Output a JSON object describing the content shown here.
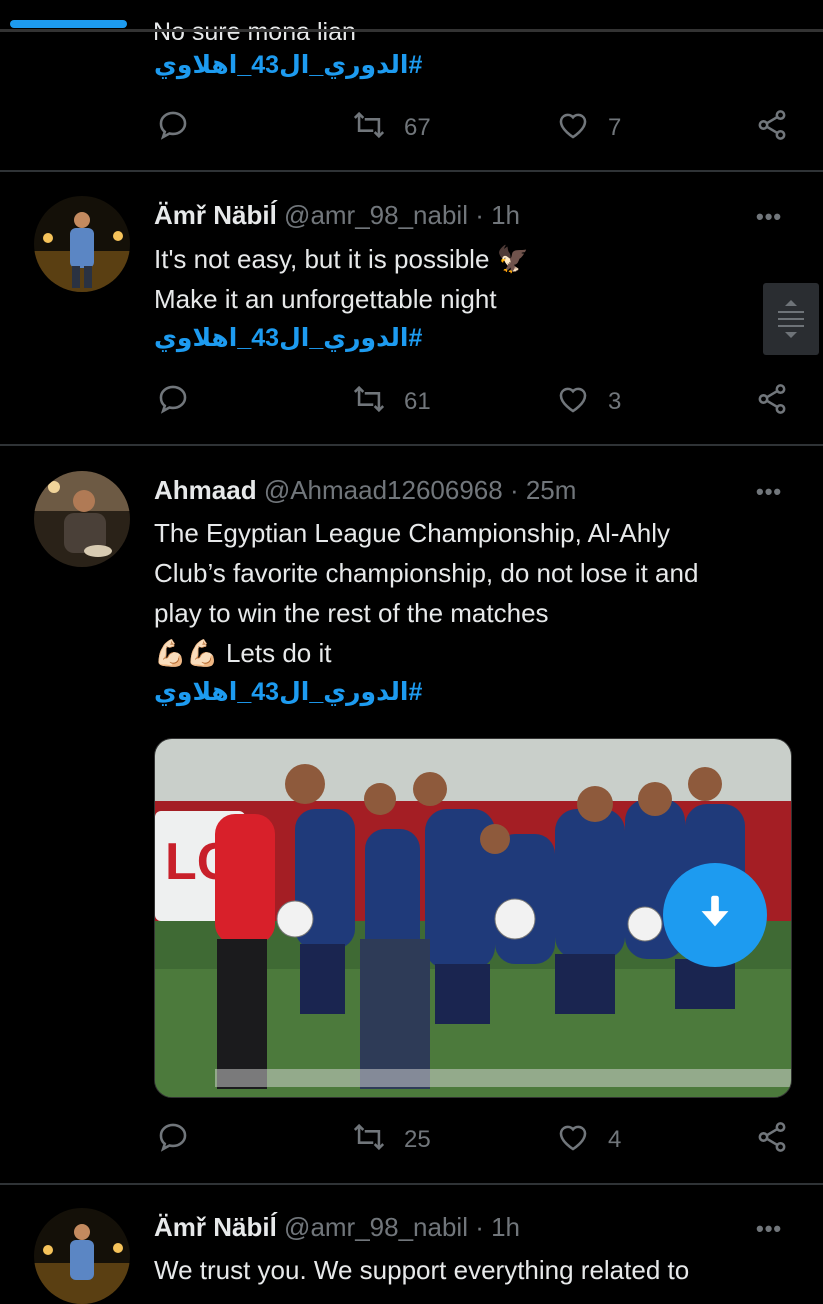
{
  "top_tweet": {
    "cut_text": "No sure mona lian",
    "hashtag": "#الدوري_ال43_اهلاوي",
    "retweets": "67",
    "likes": "7"
  },
  "tweets": [
    {
      "name": "Ämř Näbiĺ",
      "handle": "@amr_98_nabil · 1h",
      "lines": [
        "It's not easy, but it is possible 🦅",
        "Make it an unforgettable night"
      ],
      "hashtag": "#الدوري_ال43_اهلاوي",
      "retweets": "61",
      "likes": "3"
    },
    {
      "name": "Ahmaad",
      "handle": "@Ahmaad12606968 · 25m",
      "lines": [
        "The Egyptian League Championship, Al-Ahly",
        "Club’s favorite championship, do not lose it and",
        "play to win the rest of the matches",
        "💪🏻💪🏻 Lets do it"
      ],
      "hashtag": "#الدوري_ال43_اهلاوي",
      "retweets": "25",
      "likes": "4"
    },
    {
      "name": "Ämř Näbiĺ",
      "handle": "@amr_98_nabil · 1h",
      "lines": [
        "We trust you. We support everything related to"
      ]
    }
  ],
  "icons": {
    "reply": "reply-icon",
    "retweet": "retweet-icon",
    "like": "heart-icon",
    "share": "share-icon",
    "more": "more-icon",
    "download": "download-icon"
  },
  "colors": {
    "accent": "#1d9bf0",
    "background": "#000000",
    "muted": "#71767b"
  }
}
